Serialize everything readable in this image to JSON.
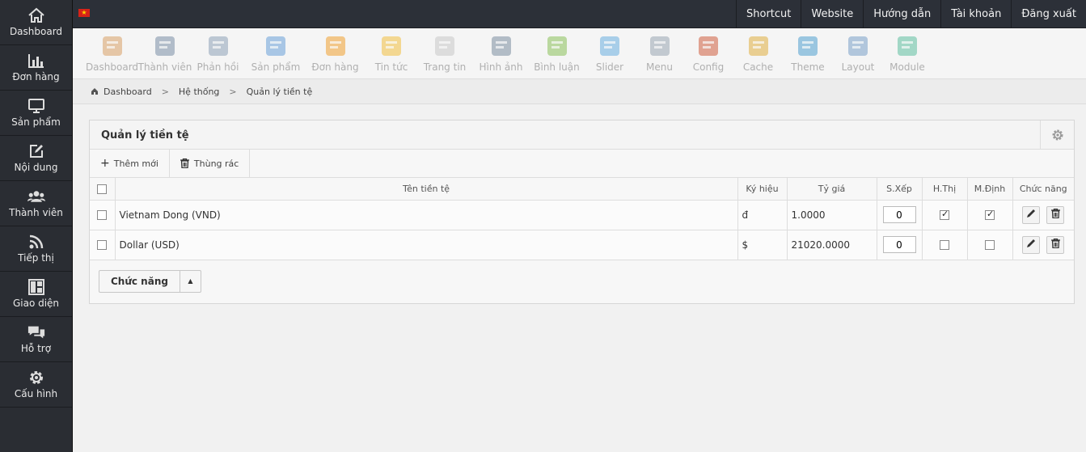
{
  "sidebar": {
    "items": [
      {
        "label": "Dashboard",
        "icon": "home-icon"
      },
      {
        "label": "Đơn hàng",
        "icon": "bar-chart-icon"
      },
      {
        "label": "Sản phẩm",
        "icon": "monitor-icon"
      },
      {
        "label": "Nội dung",
        "icon": "edit-icon"
      },
      {
        "label": "Thành viên",
        "icon": "users-icon"
      },
      {
        "label": "Tiếp thị",
        "icon": "rss-icon"
      },
      {
        "label": "Giao diện",
        "icon": "layout-icon"
      },
      {
        "label": "Hỗ trợ",
        "icon": "chat-icon"
      },
      {
        "label": "Cấu hình",
        "icon": "gear-icon"
      }
    ]
  },
  "topbar": {
    "links": [
      "Shortcut",
      "Website",
      "Hướng dẫn",
      "Tài khoản",
      "Đăng xuất"
    ]
  },
  "toolbar": {
    "items": [
      {
        "label": "Dashboard",
        "color": "#d9a066"
      },
      {
        "label": "Thành viên",
        "color": "#7b8fa6"
      },
      {
        "label": "Phản hồi",
        "color": "#8fa3b8"
      },
      {
        "label": "Sản phẩm",
        "color": "#6aa0d8"
      },
      {
        "label": "Đơn hàng",
        "color": "#f0a030"
      },
      {
        "label": "Tin tức",
        "color": "#f2c040"
      },
      {
        "label": "Trang tin",
        "color": "#c9c9c9"
      },
      {
        "label": "Hình ảnh",
        "color": "#7d8fa0"
      },
      {
        "label": "Bình luận",
        "color": "#8ac25a"
      },
      {
        "label": "Slider",
        "color": "#6bb0e0"
      },
      {
        "label": "Menu",
        "color": "#9aa6b2"
      },
      {
        "label": "Config",
        "color": "#d06040"
      },
      {
        "label": "Cache",
        "color": "#e0b040"
      },
      {
        "label": "Theme",
        "color": "#50a0d0"
      },
      {
        "label": "Layout",
        "color": "#7aa0c8"
      },
      {
        "label": "Module",
        "color": "#60c0a0"
      }
    ]
  },
  "breadcrumb": [
    "Dashboard",
    "Hệ thống",
    "Quản lý tiền tệ"
  ],
  "panel": {
    "title": "Quản lý tiền tệ",
    "add_label": "Thêm mới",
    "trash_label": "Thùng rác",
    "columns": {
      "name": "Tên tiền tệ",
      "symbol": "Ký hiệu",
      "rate": "Tỷ giá",
      "sort": "S.Xếp",
      "show": "H.Thị",
      "default": "M.Định",
      "actions": "Chức năng"
    },
    "rows": [
      {
        "name": "Vietnam Dong (VND)",
        "symbol": "đ",
        "rate": "1.0000",
        "sort": "0",
        "show": true,
        "default": true
      },
      {
        "name": "Dollar (USD)",
        "symbol": "$",
        "rate": "21020.0000",
        "sort": "0",
        "show": false,
        "default": false
      }
    ],
    "function_button": "Chức năng"
  }
}
